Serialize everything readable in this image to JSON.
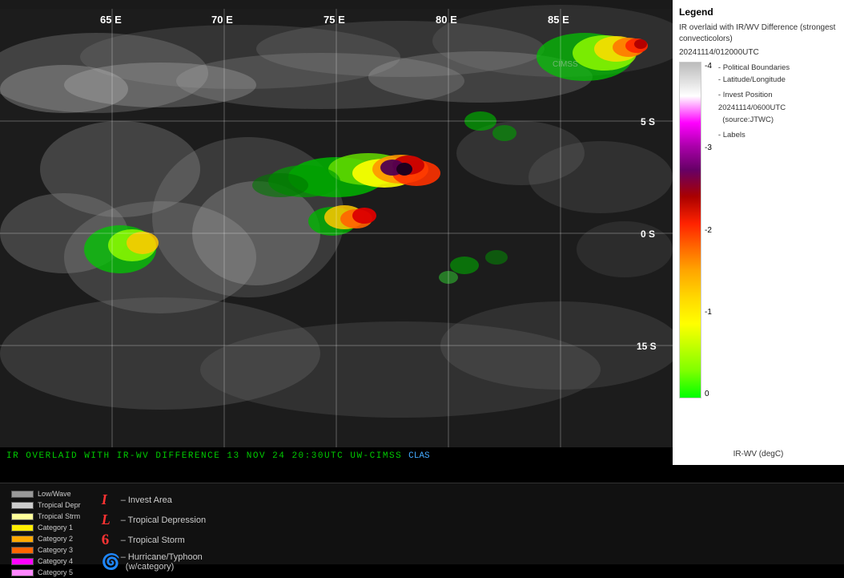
{
  "title": "IR Overlaid with IR/WV Difference",
  "legend": {
    "title": "Legend",
    "description": "IR overlaid with IR/WV Difference (strongest convecticolors)",
    "date": "20241114/012000UTC",
    "items": [
      {
        "label": "Political Boundaries"
      },
      {
        "label": "Latitude/Longitude"
      },
      {
        "label": "Invest Position  20241114/0600UTC (source:JTWC)"
      },
      {
        "label": "Labels"
      }
    ],
    "colorbar_title": "IR-WV (degC)",
    "ticks": [
      "-4",
      "-3",
      "-2",
      "-1",
      "0"
    ]
  },
  "grid": {
    "lon_labels": [
      "65 E",
      "70 E",
      "75 E",
      "80 E",
      "85 E"
    ],
    "lat_labels": [
      "5 S",
      "0 S",
      "15 S"
    ]
  },
  "status_bar": {
    "text": "IR OVERLAID WITH IR-WV DIFFERENCE    13 NOV 24   20:30UTC    UW-CIMSS"
  },
  "bottom_legend": {
    "scale_items": [
      {
        "color": "#aaaaaa",
        "label": "Low/Wave"
      },
      {
        "color": "#cccccc",
        "label": "Tropical Depr"
      },
      {
        "color": "#ffff99",
        "label": "Tropical Strm"
      },
      {
        "color": "#ffee00",
        "label": "Category 1"
      },
      {
        "color": "#ffaa00",
        "label": "Category 2"
      },
      {
        "color": "#ff6600",
        "label": "Category 3"
      },
      {
        "color": "#ff00ff",
        "label": "Category 4"
      },
      {
        "color": "#ff88ff",
        "label": "Category 5"
      }
    ],
    "symbols": [
      {
        "char": "I",
        "color": "#ff4444",
        "label": "Invest Area"
      },
      {
        "char": "L",
        "color": "#ff4444",
        "label": "Tropical Depression"
      },
      {
        "char": "6",
        "color": "#ff4444",
        "label": "Tropical Storm"
      },
      {
        "char": "6",
        "color": "#ff4444",
        "label": "Hurricane/Typhoon (w/category)"
      }
    ]
  }
}
